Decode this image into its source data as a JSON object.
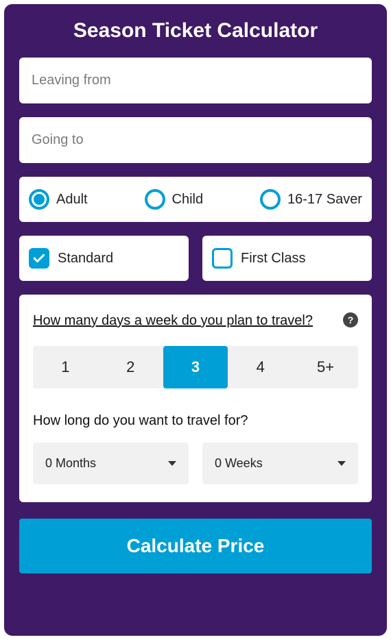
{
  "title": "Season Ticket Calculator",
  "inputs": {
    "from_placeholder": "Leaving from",
    "to_placeholder": "Going to"
  },
  "passenger_types": {
    "adult": "Adult",
    "child": "Child",
    "saver": "16-17 Saver",
    "selected": "adult"
  },
  "classes": {
    "standard": "Standard",
    "first": "First Class",
    "standard_checked": true,
    "first_checked": false
  },
  "days_question": "How many days a week do you plan to travel?",
  "days_options": {
    "d1": "1",
    "d2": "2",
    "d3": "3",
    "d4": "4",
    "d5": "5+"
  },
  "days_selected": "3",
  "duration_question": "How long do you want to travel for?",
  "duration": {
    "months": "0 Months",
    "weeks": "0 Weeks"
  },
  "calculate_label": "Calculate Price",
  "help_symbol": "?",
  "colors": {
    "brand": "#009fd6",
    "card": "#3f1a66"
  }
}
